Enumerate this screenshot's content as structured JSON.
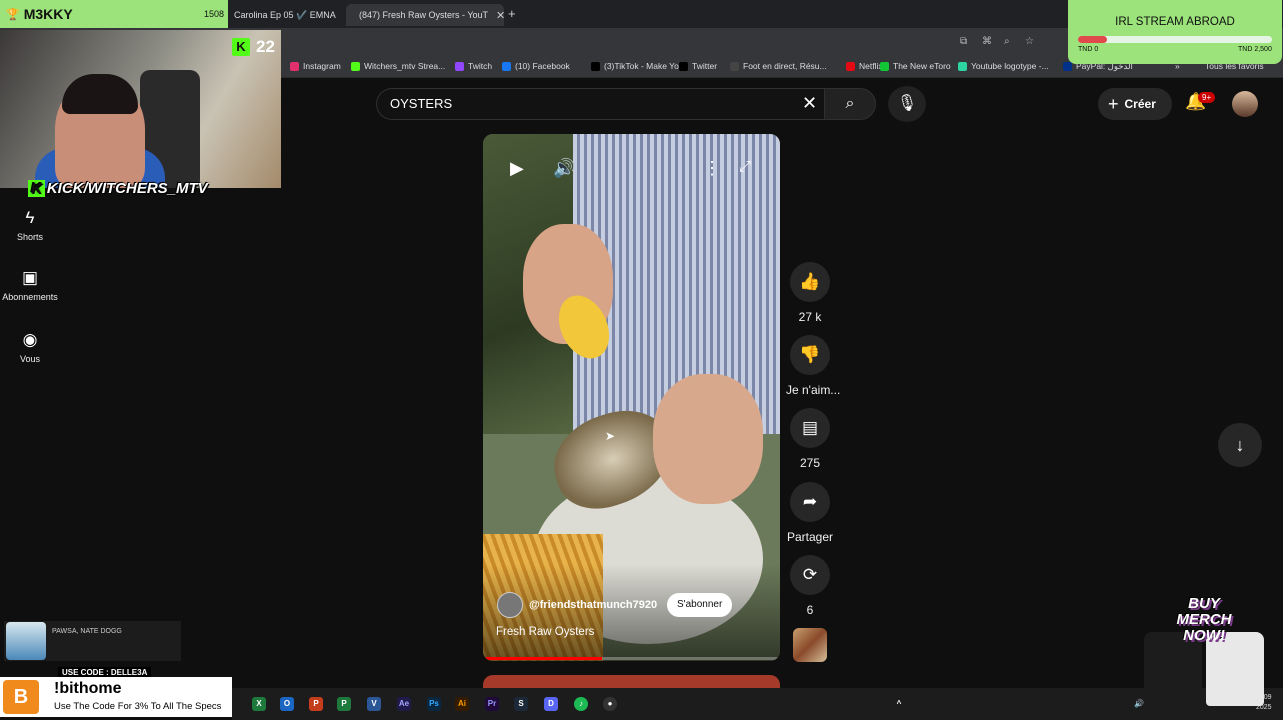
{
  "browser": {
    "tabs": [
      {
        "label": "Carolina Ep 05 ✔️ EMNA",
        "active": false
      },
      {
        "label": "(847) Fresh Raw Oysters - YouT",
        "active": true
      }
    ],
    "bookmarks": [
      {
        "label": "Instagram",
        "color": "#e1306c"
      },
      {
        "label": "Witchers_mtv Strea...",
        "color": "#53fc18"
      },
      {
        "label": "Twitch",
        "color": "#9146ff"
      },
      {
        "label": "(10) Facebook",
        "color": "#1877f2"
      },
      {
        "label": "(3)TikTok - Make Yo...",
        "color": "#000000"
      },
      {
        "label": "Twitter",
        "color": "#000000"
      },
      {
        "label": "Foot en direct, Résu...",
        "color": "#444444"
      },
      {
        "label": "Netflix",
        "color": "#e50914"
      },
      {
        "label": "The New eToro",
        "color": "#13c636"
      },
      {
        "label": "Youtube logotype -...",
        "color": "#2bd4a0"
      },
      {
        "label": "PayPal: الدخول",
        "color": "#003087"
      }
    ],
    "all_bookmarks": "Tous les favoris"
  },
  "youtube": {
    "search_value": "OYSTERS",
    "create_label": "Créer",
    "notifications_badge": "9+",
    "sidebar": [
      {
        "label": "Shorts",
        "icon": "shorts-icon"
      },
      {
        "label": "Abonnements",
        "icon": "subscriptions-icon"
      },
      {
        "label": "Vous",
        "icon": "you-icon"
      }
    ],
    "short": {
      "channel": "@friendsthatmunch7920",
      "subscribe_label": "S'abonner",
      "title": "Fresh Raw Oysters",
      "progress_fraction": 0.4
    },
    "actions": {
      "likes": "27 k",
      "dislike": "Je n'aim...",
      "comments": "275",
      "share": "Partager",
      "remix": "6"
    }
  },
  "stream": {
    "streamer": "M3KKY",
    "streamer_count": "1508",
    "kick_viewers": "22",
    "kick_channel": "KICK/WITCHERS_MTV",
    "goal": {
      "title": "IRL STREAM ABROAD",
      "min": "TND 0",
      "max": "TND 2,500",
      "fraction": 0.15
    },
    "music_artist": "PAWSA, NATE DOGG",
    "promo_code": "USE CODE : DELLE3A",
    "promo_command": "!bithome",
    "promo_text": "Use The Code For 3% To All The Specs",
    "merch": "BUY MERCH NOW!"
  },
  "taskbar": {
    "clock_time": "3:09",
    "clock_date": "2025"
  }
}
